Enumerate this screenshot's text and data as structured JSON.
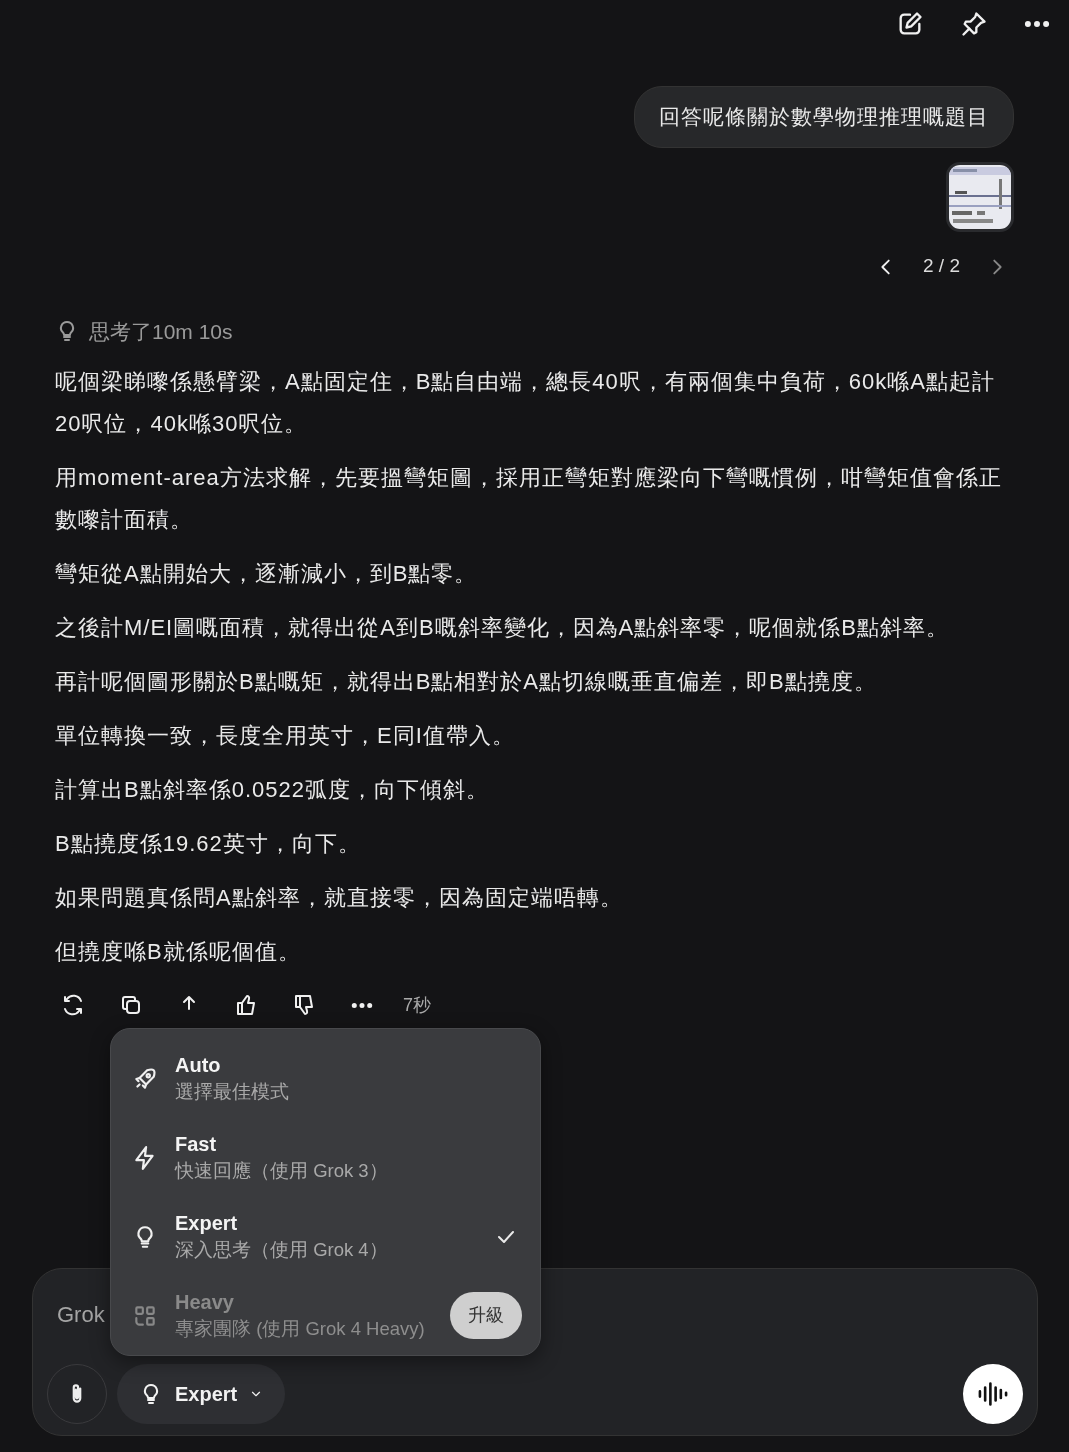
{
  "user_message": {
    "text": "回答呢條關於數學物理推理嘅題目",
    "pager": "2 / 2"
  },
  "thinking": {
    "label": "思考了10m 10s"
  },
  "answer": {
    "paragraphs": [
      "呢個梁睇嚟係懸臂梁，A點固定住，B點自由端，總長40呎，有兩個集中負荷，60k喺A點起計20呎位，40k喺30呎位。",
      "用moment-area方法求解，先要搵彎矩圖，採用正彎矩對應梁向下彎嘅慣例，咁彎矩值會係正數嚟計面積。",
      "彎矩從A點開始大，逐漸減小，到B點零。",
      "之後計M/EI圖嘅面積，就得出從A到B嘅斜率變化，因為A點斜率零，呢個就係B點斜率。",
      "再計呢個圖形關於B點嘅矩，就得出B點相對於A點切線嘅垂直偏差，即B點撓度。",
      "單位轉換一致，長度全用英寸，E同I值帶入。",
      "計算出B點斜率係0.0522弧度，向下傾斜。",
      "B點撓度係19.62英寸，向下。",
      "如果問題真係問A點斜率，就直接零，因為固定端唔轉。",
      "但撓度喺B就係呢個值。"
    ],
    "time": "7秒"
  },
  "mode_menu": {
    "items": [
      {
        "title": "Auto",
        "subtitle": "選擇最佳模式",
        "selected": false,
        "disabled": false
      },
      {
        "title": "Fast",
        "subtitle": "快速回應（使用 Grok 3）",
        "selected": false,
        "disabled": false
      },
      {
        "title": "Expert",
        "subtitle": "深入思考（使用 Grok 4）",
        "selected": true,
        "disabled": false
      },
      {
        "title": "Heavy",
        "subtitle": "專家團隊 (使用 Grok 4 Heavy)",
        "selected": false,
        "disabled": true,
        "action": "升級"
      }
    ]
  },
  "composer": {
    "placeholder": "Grok",
    "mode_button": "Expert"
  }
}
